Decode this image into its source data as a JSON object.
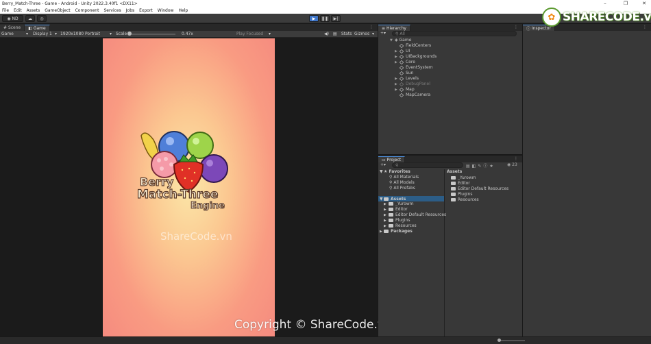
{
  "window": {
    "title": "Berry_Match-Three - Game - Android - Unity 2022.3.40f1 <DX11>"
  },
  "menu": [
    "File",
    "Edit",
    "Assets",
    "GameObject",
    "Component",
    "Services",
    "Jobs",
    "Export",
    "Window",
    "Help"
  ],
  "toolbar": {
    "account_label": "ND",
    "colors": {
      "play_active": "#3f76c9"
    }
  },
  "scene_tabs": {
    "scene": "Scene",
    "game": "Game"
  },
  "game_toolbar": {
    "mode": "Game",
    "display": "Display 1",
    "resolution": "1920x1080 Portrait",
    "scale_label": "Scale",
    "scale_value": "0.47x",
    "play_focused": "Play Focused",
    "stats": "Stats",
    "gizmos": "Gizmos"
  },
  "game_logo": {
    "line1": "Berry",
    "line2": "Match-Three",
    "line3": "Engine"
  },
  "hierarchy": {
    "tab": "Hierarchy",
    "search_placeholder": "All",
    "scene_root": "Game",
    "items": [
      "FieldCenters",
      "UI",
      "UIBackgrounds",
      "Core",
      "EventSystem",
      "Sun",
      "Levels",
      "DebugPanel",
      "Map",
      "MapCamera"
    ]
  },
  "project": {
    "tab": "Project",
    "count": "23",
    "favorites_label": "Favorites",
    "favorites": [
      "All Materials",
      "All Models",
      "All Prefabs"
    ],
    "assets_label": "Assets",
    "asset_folders": [
      "_Yurowm",
      "Editor",
      "Editor Default Resources",
      "Plugins",
      "Resources"
    ],
    "packages_label": "Packages",
    "assets_header": "Assets",
    "grid_items": [
      "_Yurowm",
      "Editor",
      "Editor Default Resources",
      "Plugins",
      "Resources"
    ]
  },
  "inspector": {
    "tab": "Inspector"
  },
  "watermark": {
    "logo_text": "SHARECODE.vn",
    "center_text": "ShareCode.vn",
    "copyright": "Copyright © ShareCode.vn"
  }
}
